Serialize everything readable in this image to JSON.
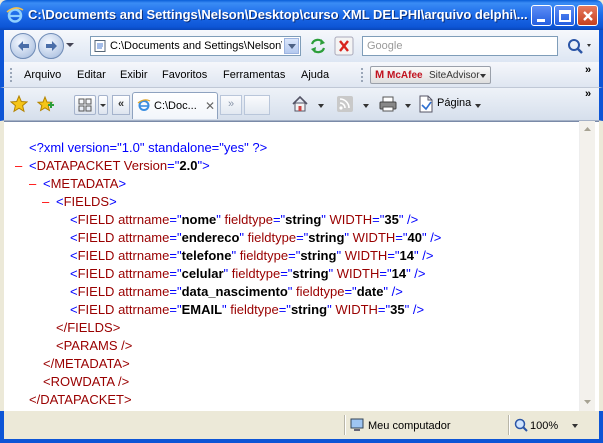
{
  "window": {
    "title": "C:\\Documents and Settings\\Nelson\\Desktop\\curso XML DELPHI\\arquivo delphi\\..."
  },
  "address": {
    "url": "C:\\Documents and Settings\\Nelson\\D",
    "search_placeholder": "Google"
  },
  "menu": {
    "items": [
      "Arquivo",
      "Editar",
      "Exibir",
      "Favoritos",
      "Ferramentas",
      "Ajuda"
    ],
    "mcafee_brand": "McAfee",
    "mcafee_product": "SiteAdvisor",
    "chevron": "»"
  },
  "tabs": {
    "scroll_left": "«",
    "active_label": "C:\\Doc...",
    "close": "✕",
    "next": "»",
    "page_label": "Página",
    "chevron": "»"
  },
  "xml_lines": {
    "l1": "<?xml version=\"1.0\" standalone=\"yes\" ?>",
    "l2_tag": "DATAPACKET",
    "l2_attr": "Version",
    "l2_val": "2.0",
    "l3_tag": "METADATA",
    "l4_tag": "FIELDS",
    "fields": [
      {
        "attrname": "nome",
        "fieldtype": "string",
        "width": "35"
      },
      {
        "attrname": "endereco",
        "fieldtype": "string",
        "width": "40"
      },
      {
        "attrname": "telefone",
        "fieldtype": "string",
        "width": "14"
      },
      {
        "attrname": "celular",
        "fieldtype": "string",
        "width": "14"
      },
      {
        "attrname": "data_nascimento",
        "fieldtype": "date",
        "width": ""
      },
      {
        "attrname": "EMAIL",
        "fieldtype": "string",
        "width": "35"
      }
    ],
    "field_tag": "FIELD",
    "attr_attrname": "attrname",
    "attr_fieldtype": "fieldtype",
    "attr_width": "WIDTH",
    "close_fields": "</FIELDS>",
    "params": "<PARAMS />",
    "close_metadata": "</METADATA>",
    "rowdata": "<ROWDATA />",
    "close_datapacket": "</DATAPACKET>",
    "minus": "–"
  },
  "status": {
    "zone": "Meu computador",
    "zoom": "100%"
  }
}
